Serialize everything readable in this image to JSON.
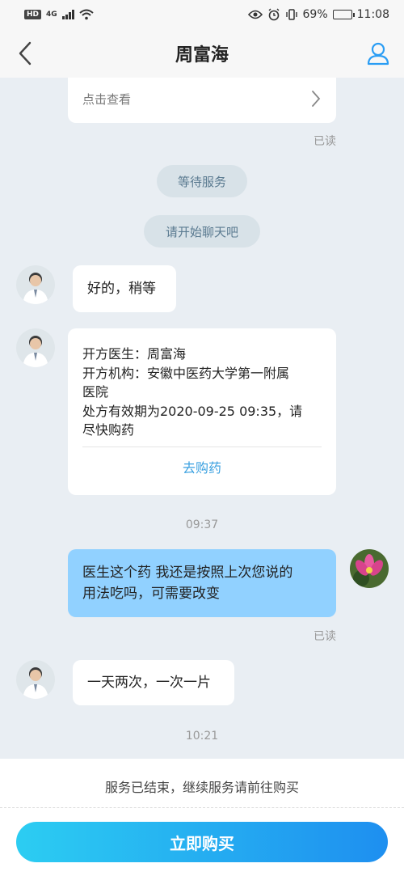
{
  "status_bar": {
    "network_badge": "HD",
    "network_type": "4G",
    "battery": "69%",
    "time": "11:08",
    "battery_level": 0.69
  },
  "nav": {
    "title": "周富海"
  },
  "card_top": {
    "link_text": "点击查看",
    "read_status": "已读"
  },
  "pills": {
    "waiting": "等待服务",
    "start_chat": "请开始聊天吧"
  },
  "messages": {
    "m1": "好的，稍等",
    "rx": {
      "line1": "开方医生：周富海",
      "line2": "开方机构：安徽中医药大学第一附属",
      "line3": "医院",
      "line4": "处方有效期为2020-09-25 09:35，请",
      "line5": "尽快购药",
      "action": "去购药"
    },
    "time1": "09:37",
    "me_line1": "医生这个药 我还是按照上次您说的",
    "me_line2": "用法吃吗，可需要改变",
    "me_read": "已读",
    "m3": "一天两次，一次一片",
    "time2": "10:21"
  },
  "bottom": {
    "ended_text": "服务已结束，继续服务请前往购买",
    "buy_button": "立即购买"
  },
  "colors": {
    "accent": "#1e8ff0",
    "my_bubble": "#91d1ff",
    "background": "#e9eef3",
    "link": "#3aa0e0"
  }
}
